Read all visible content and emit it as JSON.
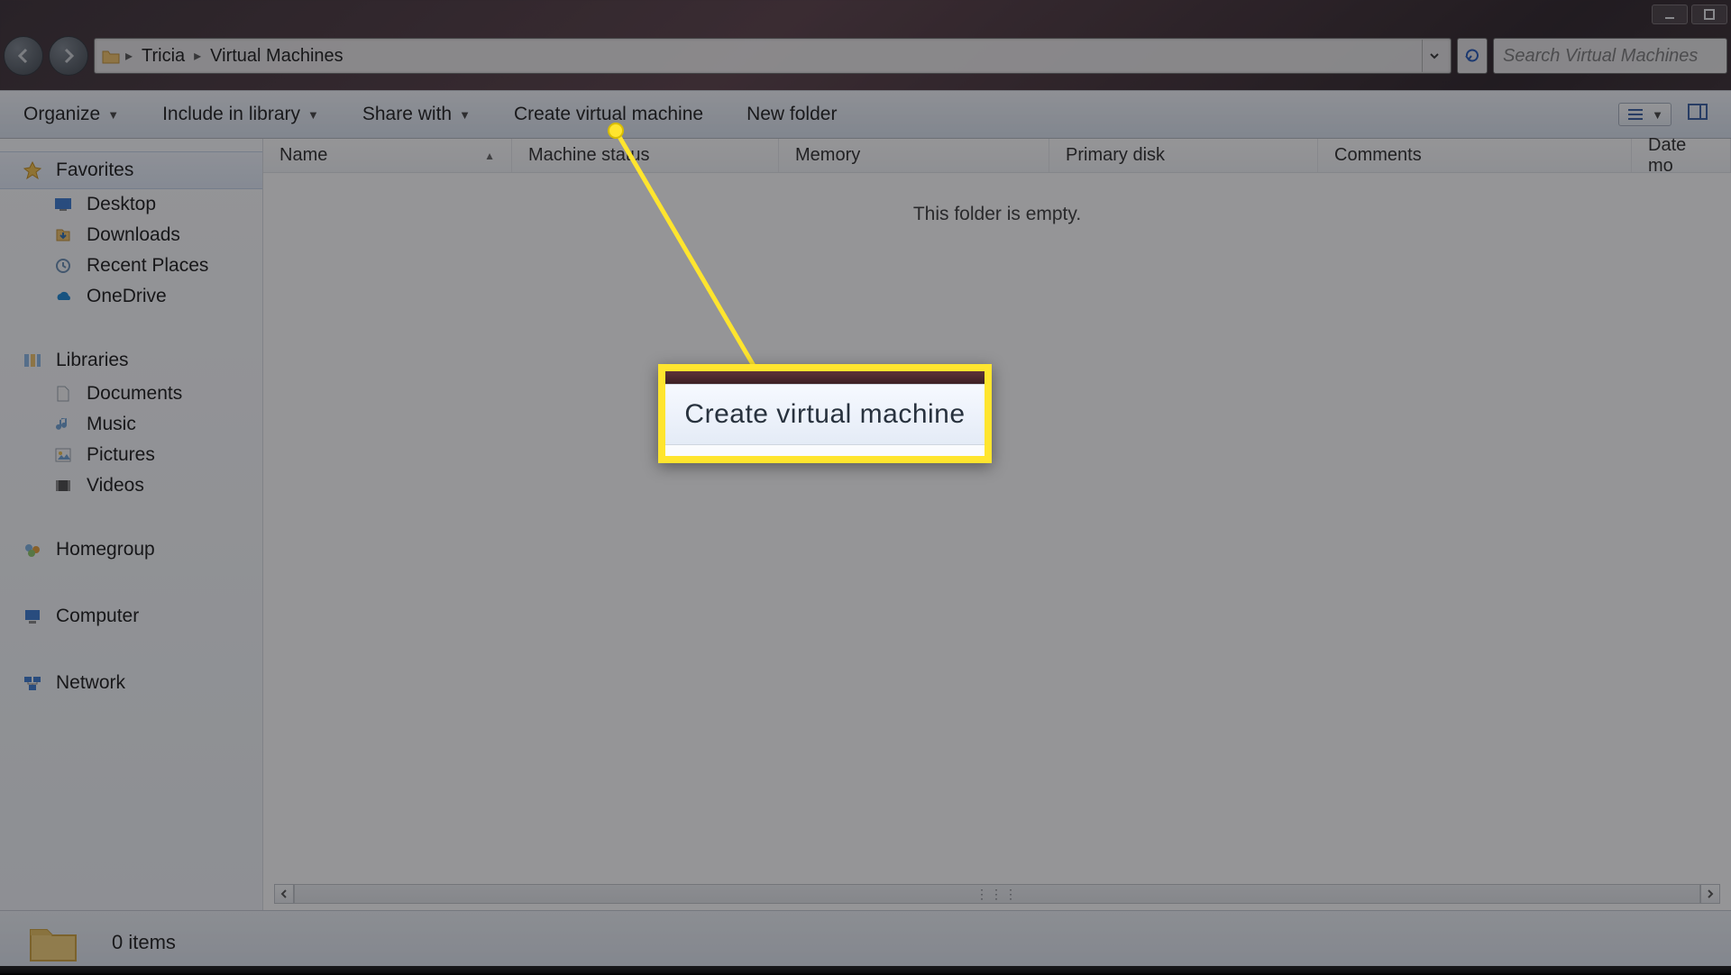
{
  "breadcrumb": {
    "user": "Tricia",
    "folder": "Virtual Machines"
  },
  "search": {
    "placeholder": "Search Virtual Machines"
  },
  "toolbar": {
    "organize": "Organize",
    "include": "Include in library",
    "share": "Share with",
    "create_vm": "Create virtual machine",
    "new_folder": "New folder"
  },
  "sidebar": {
    "favorites": "Favorites",
    "desktop": "Desktop",
    "downloads": "Downloads",
    "recent": "Recent Places",
    "onedrive": "OneDrive",
    "libraries": "Libraries",
    "documents": "Documents",
    "music": "Music",
    "pictures": "Pictures",
    "videos": "Videos",
    "homegroup": "Homegroup",
    "computer": "Computer",
    "network": "Network"
  },
  "columns": {
    "name": "Name",
    "status": "Machine status",
    "memory": "Memory",
    "disk": "Primary disk",
    "comments": "Comments",
    "datemod": "Date mo"
  },
  "content": {
    "empty": "This folder is empty."
  },
  "status": {
    "items": "0 items"
  },
  "callout": {
    "label": "Create virtual machine"
  }
}
